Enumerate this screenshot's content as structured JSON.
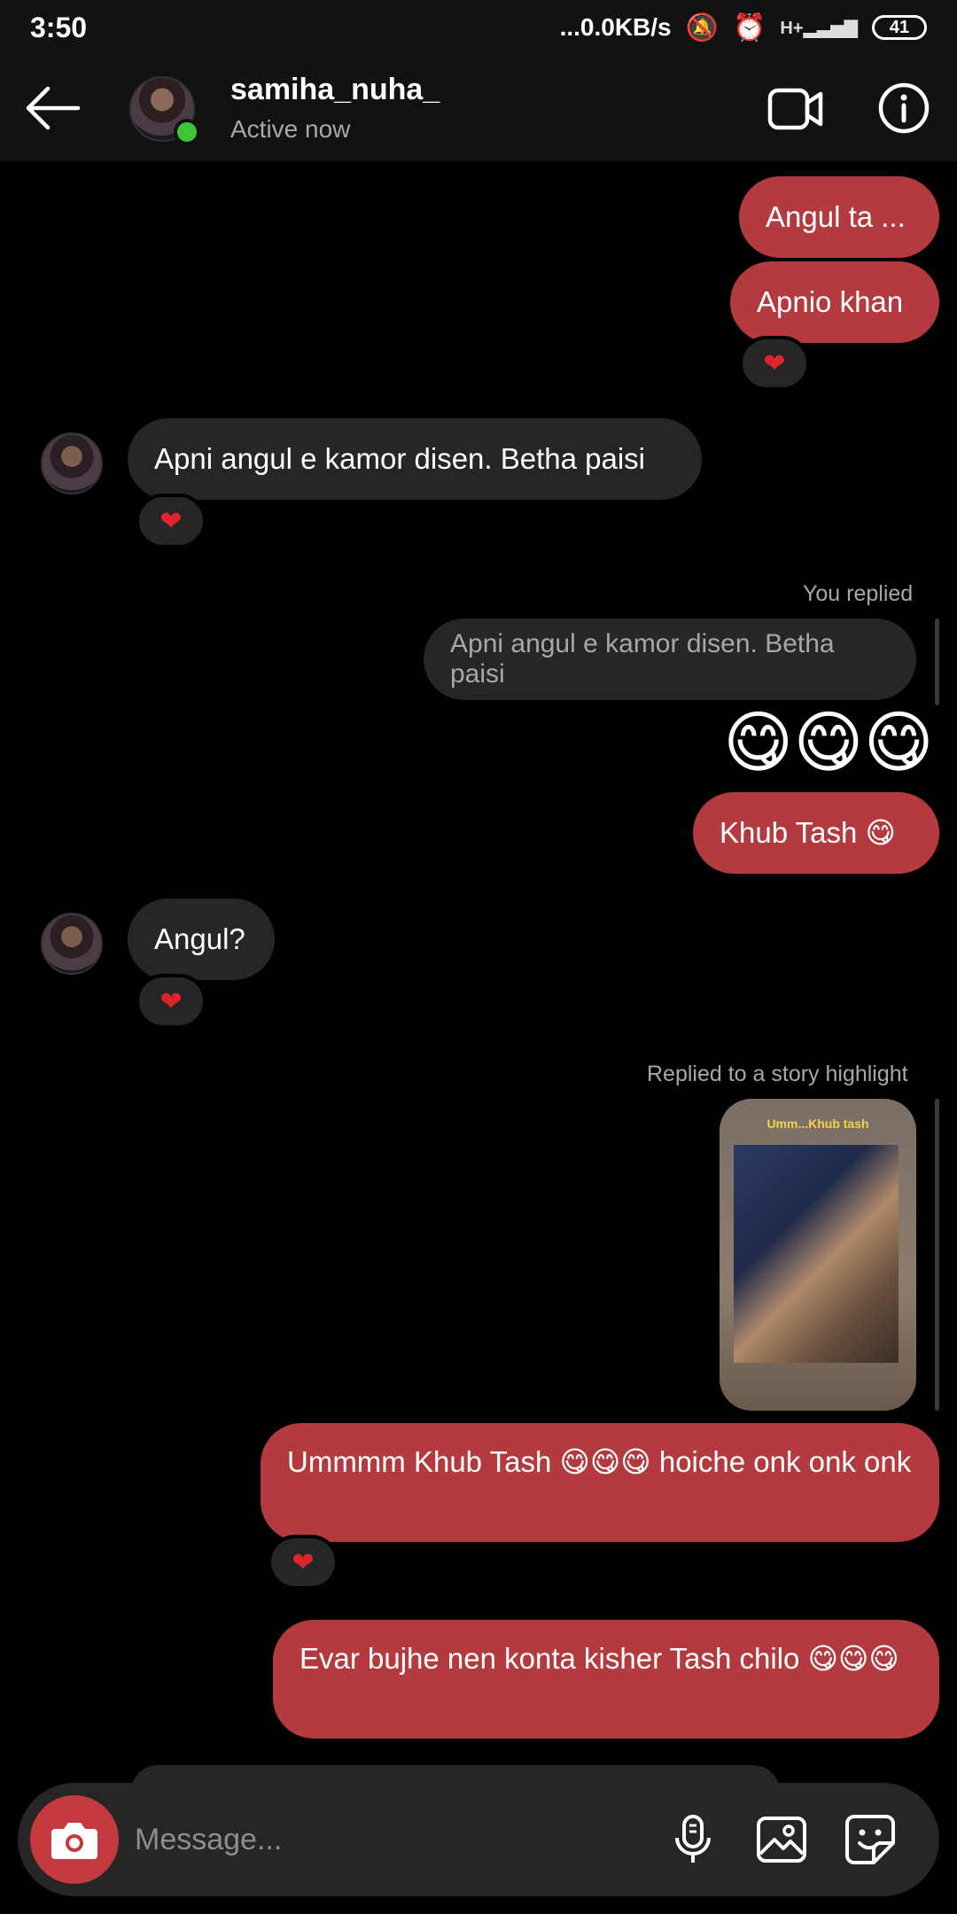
{
  "status_bar": {
    "time": "3:50",
    "network_speed": "...0.0KB/s",
    "network_type": "H+",
    "battery": "41"
  },
  "header": {
    "username": "samiha_nuha_",
    "status": "Active now"
  },
  "messages": [
    {
      "sender": "me",
      "text": "Angul ta ..."
    },
    {
      "sender": "me",
      "text": "Apnio khan",
      "reaction": "❤"
    },
    {
      "sender": "them",
      "text": "Apni angul e kamor disen. Betha paisi",
      "reaction": "❤"
    },
    {
      "sender": "me",
      "reply_label": "You replied",
      "quoted": "Apni angul e kamor disen. Betha paisi",
      "text": "😋😋😋"
    },
    {
      "sender": "me",
      "text": "Khub Tash 😋"
    },
    {
      "sender": "them",
      "text": "Angul?",
      "reaction": "❤"
    },
    {
      "sender": "me",
      "reply_label": "Replied to a story highlight",
      "story_caption": "Umm...Khub tash"
    },
    {
      "sender": "me",
      "text": "Ummmm Khub Tash 😋😋😋 hoiche onk onk onk",
      "reaction": "❤"
    },
    {
      "sender": "me",
      "text": "Evar bujhe nen konta kisher Tash chilo 😋😋😋"
    }
  ],
  "composer": {
    "placeholder": "Message..."
  },
  "colors": {
    "outgoing_bubble": "#b33a3f",
    "incoming_bubble": "#262626",
    "online": "#3ec43a",
    "reaction_heart": "#e0242f"
  },
  "icons": [
    "back-arrow-icon",
    "video-camera-icon",
    "info-icon",
    "camera-icon",
    "microphone-icon",
    "gallery-icon",
    "sticker-icon",
    "heart-icon"
  ]
}
